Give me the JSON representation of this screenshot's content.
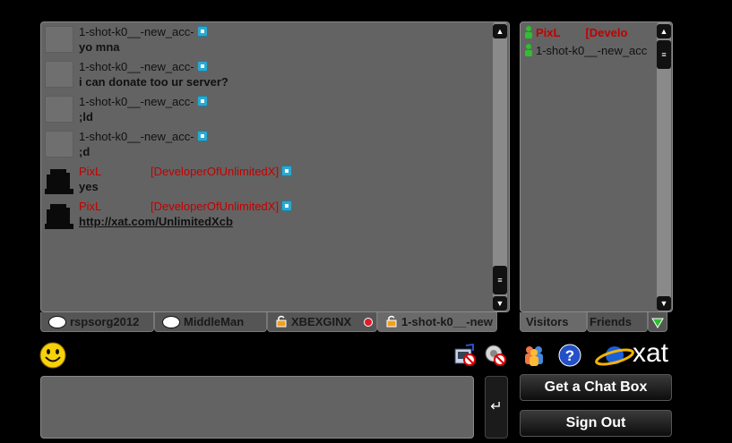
{
  "messages": [
    {
      "name": "1-shot-k0__-new_acc-",
      "tag": "",
      "text": "yo mna",
      "link": false
    },
    {
      "name": "1-shot-k0__-new_acc-",
      "tag": "",
      "text": "i can donate too ur server?",
      "link": false
    },
    {
      "name": "1-shot-k0__-new_acc-",
      "tag": "",
      "text": ";ld",
      "link": false
    },
    {
      "name": "1-shot-k0__-new_acc-",
      "tag": "",
      "text": ";d",
      "link": false
    },
    {
      "name": "PixL",
      "tag": "[DeveloperOfUnlimitedX]",
      "text": "yes",
      "link": false
    },
    {
      "name": "PixL",
      "tag": "[DeveloperOfUnlimitedX]",
      "text": "http://xat.com/UnlimitedXcb",
      "link": true
    }
  ],
  "tabs": [
    {
      "label": "rspsorg2012"
    },
    {
      "label": "MiddleMan"
    },
    {
      "label": "XBEXGINX"
    },
    {
      "label": "1-shot-k0__-new"
    }
  ],
  "visitors": [
    {
      "name": "PixL",
      "tag": "[Develo"
    },
    {
      "name": "1-shot-k0__-new_acc",
      "tag": ""
    }
  ],
  "visitor_tabs": {
    "visitors": "Visitors",
    "friends": "Friends"
  },
  "buttons": {
    "get_chat_box": "Get a Chat Box",
    "sign_out": "Sign Out"
  },
  "logo_text": "xat",
  "colors": {
    "panel": "#636363",
    "name_red": "#c20000",
    "background": "#000000"
  }
}
